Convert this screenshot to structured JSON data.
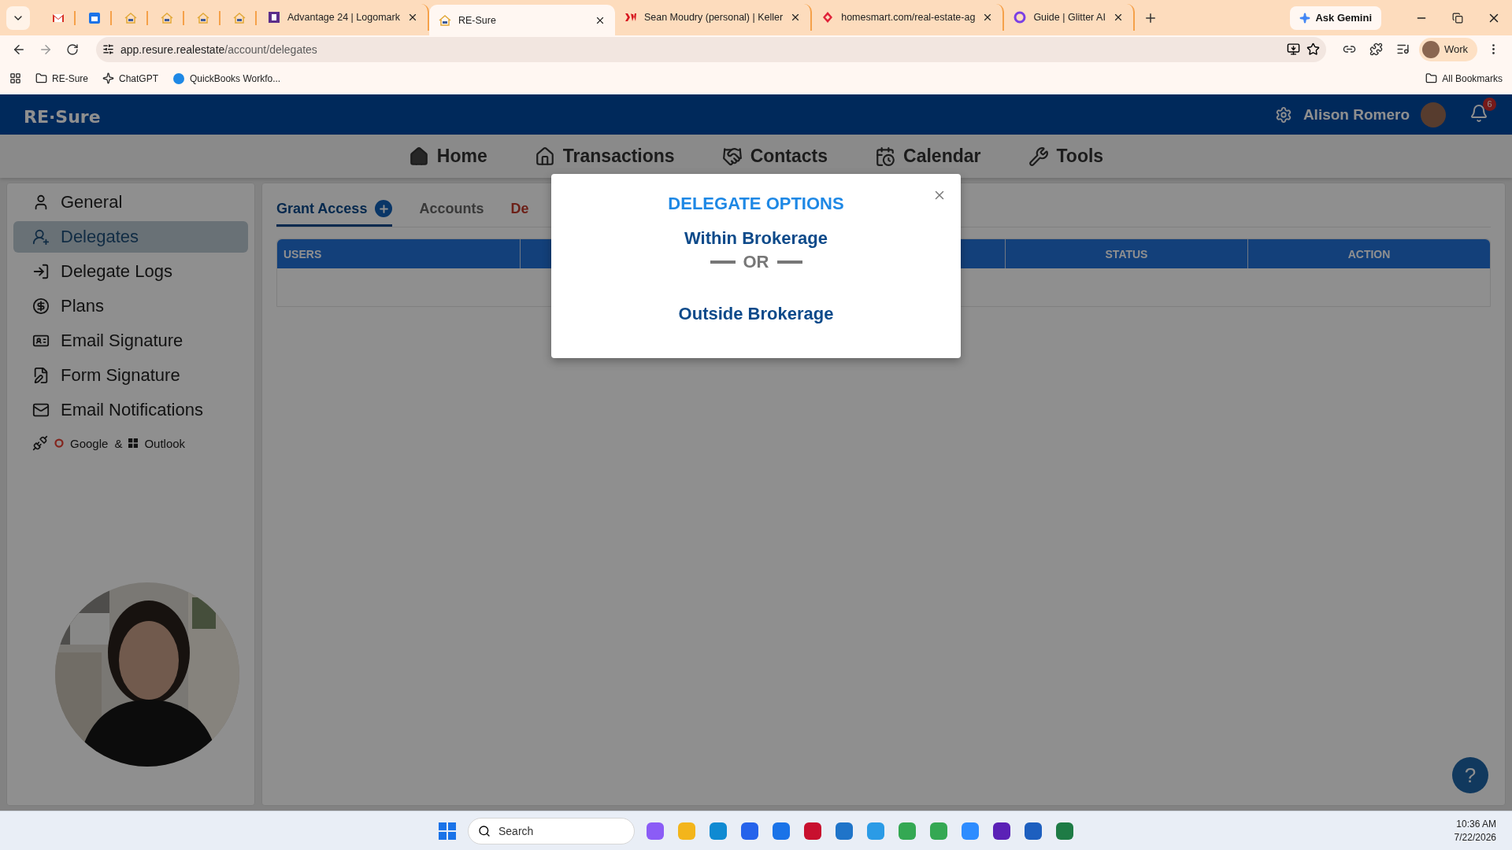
{
  "browser": {
    "pinned_tabs": [
      {
        "kind": "mail"
      },
      {
        "kind": "calendar"
      },
      {
        "kind": "house"
      },
      {
        "kind": "house"
      },
      {
        "kind": "house"
      },
      {
        "kind": "house"
      }
    ],
    "tabs": [
      {
        "title": "Advantage 24 | Logomark",
        "kind": "square",
        "selected": false
      },
      {
        "title": "RE-Sure",
        "kind": "house",
        "selected": true
      },
      {
        "title": "Sean Moudry (personal) | Keller",
        "kind": "mark",
        "selected": false
      },
      {
        "title": "homesmart.com/real-estate-ag",
        "kind": "diamond",
        "selected": false
      },
      {
        "title": "Guide | Glitter AI",
        "kind": "glitter",
        "selected": false
      }
    ],
    "gemini_button": "Ask Gemini",
    "url": {
      "host": "app.resure.realestate",
      "path": "/account/delegates"
    },
    "profile": "Work",
    "bookmarks": [
      {
        "label": "RE-Sure",
        "kind": "folder"
      },
      {
        "label": "ChatGPT",
        "kind": "chat"
      },
      {
        "label": "QuickBooks Workfo...",
        "kind": "circle"
      }
    ],
    "all_bookmarks": "All Bookmarks"
  },
  "app": {
    "logo": "RE·Sure",
    "user_name": "Alison Romero",
    "notification_count": "6",
    "nav": [
      {
        "label": "Home",
        "kind": "home"
      },
      {
        "label": "Transactions",
        "kind": "house"
      },
      {
        "label": "Contacts",
        "kind": "handshake"
      },
      {
        "label": "Calendar",
        "kind": "calendar"
      },
      {
        "label": "Tools",
        "kind": "wrench"
      }
    ],
    "sidebar": [
      {
        "label": "General",
        "kind": "user",
        "selected": false
      },
      {
        "label": "Delegates",
        "kind": "delegates",
        "selected": true
      },
      {
        "label": "Delegate Logs",
        "kind": "logs",
        "selected": false
      },
      {
        "label": "Plans",
        "kind": "dollar",
        "selected": false
      },
      {
        "label": "Email Signature",
        "kind": "card",
        "selected": false
      },
      {
        "label": "Form Signature",
        "kind": "pen",
        "selected": false
      },
      {
        "label": "Email Notifications",
        "kind": "mail",
        "selected": false
      }
    ],
    "sync": {
      "google": "Google",
      "joiner": "&",
      "outlook": "Outlook"
    },
    "tabs": [
      {
        "label": "Grant Access",
        "kind": "add",
        "selected": true
      },
      {
        "label": "Accounts",
        "kind": "plain",
        "selected": false
      },
      {
        "label": "De",
        "kind": "danger",
        "selected": false
      }
    ],
    "table": {
      "columns": [
        "USERS",
        "STATUS",
        "ACTION"
      ]
    },
    "help_button": "?"
  },
  "modal": {
    "title": "DELEGATE OPTIONS",
    "options": [
      "Within Brokerage",
      "Outside Brokerage"
    ],
    "separator": "OR"
  },
  "taskbar": {
    "search_placeholder": "Search",
    "time": "10:36 AM",
    "date": "7/22/2026"
  }
}
